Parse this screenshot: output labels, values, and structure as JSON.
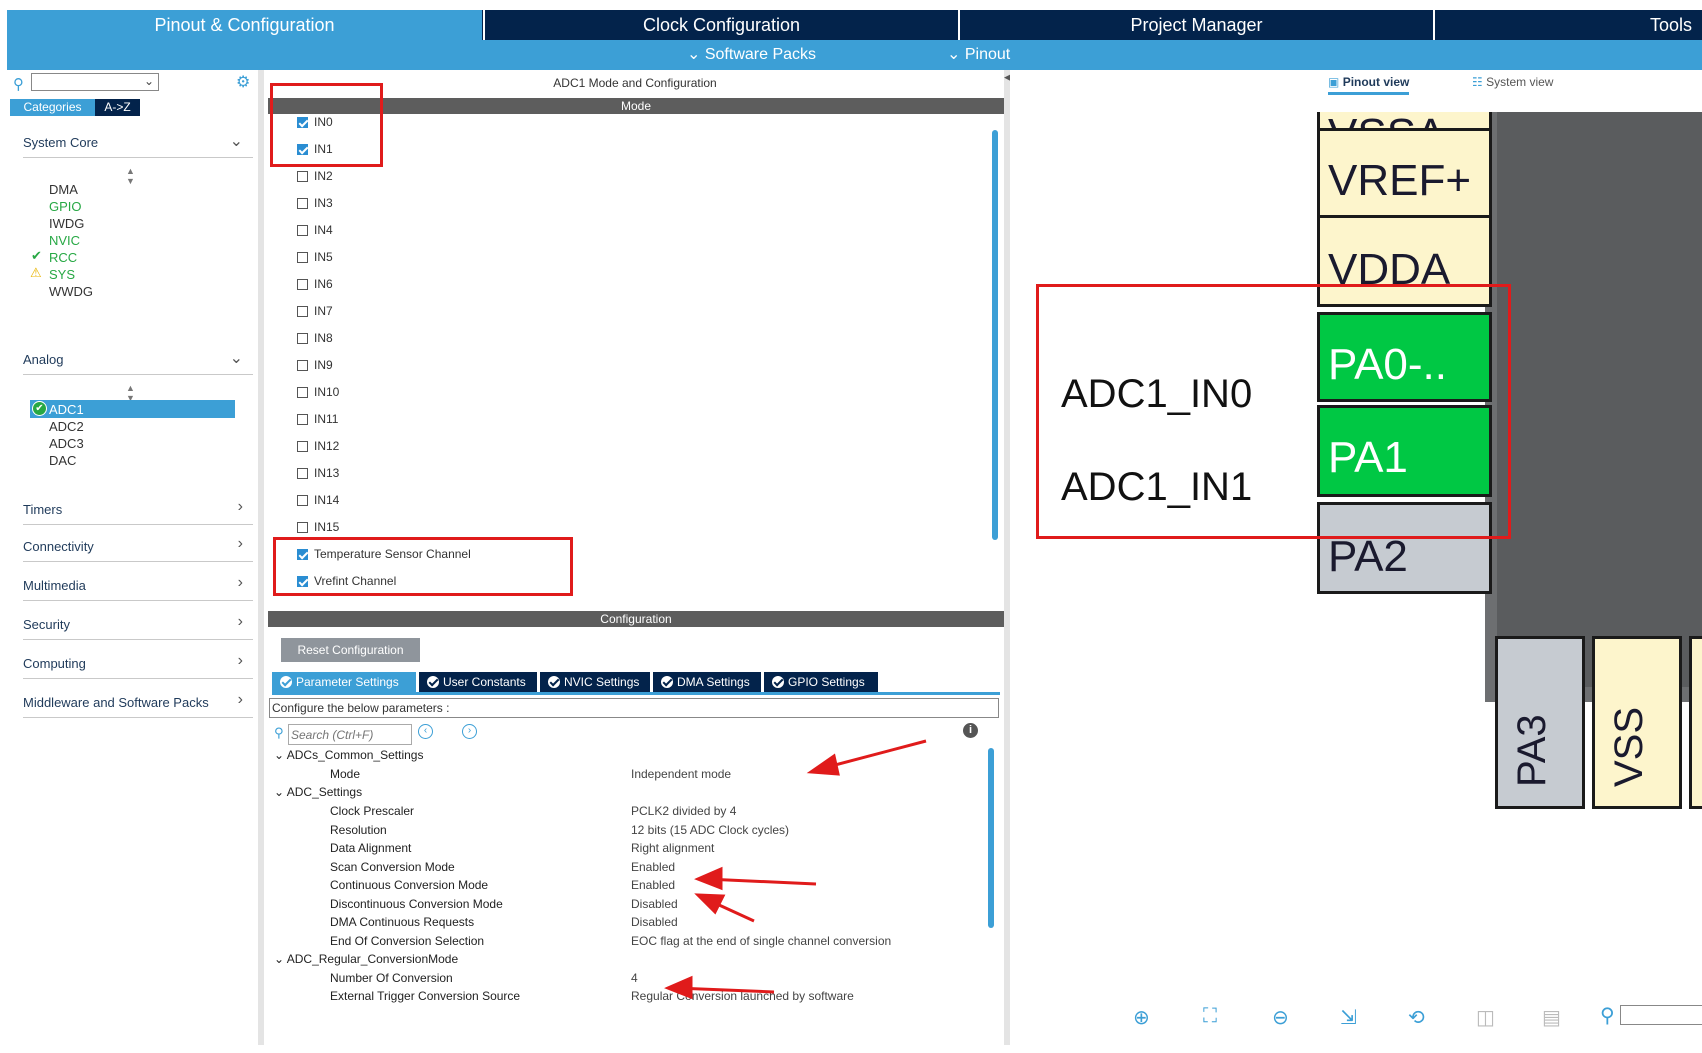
{
  "top_tabs": [
    "Pinout & Configuration",
    "Clock Configuration",
    "Project Manager",
    "Tools"
  ],
  "sub_menu": {
    "software_packs": "Software Packs",
    "pinout": "Pinout"
  },
  "left": {
    "tabs": [
      "Categories",
      "A->Z"
    ],
    "system_core": {
      "label": "System Core",
      "items": [
        "DMA",
        "GPIO",
        "IWDG",
        "NVIC",
        "RCC",
        "SYS",
        "WWDG"
      ]
    },
    "analog": {
      "label": "Analog",
      "items": [
        "ADC1",
        "ADC2",
        "ADC3",
        "DAC"
      ]
    },
    "categories": [
      "Timers",
      "Connectivity",
      "Multimedia",
      "Security",
      "Computing",
      "Middleware and Software Packs"
    ]
  },
  "mid": {
    "title": "ADC1 Mode and Configuration",
    "mode_header": "Mode",
    "channels": [
      "IN0",
      "IN1",
      "IN2",
      "IN3",
      "IN4",
      "IN5",
      "IN6",
      "IN7",
      "IN8",
      "IN9",
      "IN10",
      "IN11",
      "IN12",
      "IN13",
      "IN14",
      "IN15",
      "Temperature Sensor Channel",
      "Vrefint Channel"
    ],
    "checked": [
      true,
      true,
      false,
      false,
      false,
      false,
      false,
      false,
      false,
      false,
      false,
      false,
      false,
      false,
      false,
      false,
      true,
      true
    ],
    "config_header": "Configuration",
    "reset_button": "Reset Configuration",
    "config_tabs": [
      "Parameter Settings",
      "User Constants",
      "NVIC Settings",
      "DMA Settings",
      "GPIO Settings"
    ],
    "config_note": "Configure the below parameters :",
    "search_placeholder": "Search (Ctrl+F)",
    "params": {
      "common_group": "ADCs_Common_Settings",
      "mode": {
        "label": "Mode",
        "value": "Independent mode"
      },
      "adc_group": "ADC_Settings",
      "clock_prescaler": {
        "label": "Clock Prescaler",
        "value": "PCLK2 divided by 4"
      },
      "resolution": {
        "label": "Resolution",
        "value": "12 bits (15 ADC Clock cycles)"
      },
      "data_alignment": {
        "label": "Data Alignment",
        "value": "Right alignment"
      },
      "scan_mode": {
        "label": "Scan Conversion Mode",
        "value": "Enabled"
      },
      "continuous_mode": {
        "label": "Continuous Conversion Mode",
        "value": "Enabled"
      },
      "discontinuous_mode": {
        "label": "Discontinuous Conversion Mode",
        "value": "Disabled"
      },
      "dma_requests": {
        "label": "DMA Continuous Requests",
        "value": "Disabled"
      },
      "eoc_selection": {
        "label": "End Of Conversion Selection",
        "value": "EOC flag at the end of single channel conversion"
      },
      "regular_group": "ADC_Regular_ConversionMode",
      "num_conversion": {
        "label": "Number Of Conversion",
        "value": "4"
      },
      "ext_trigger_source": {
        "label": "External Trigger Conversion Source",
        "value": "Regular Conversion launched by software"
      }
    }
  },
  "right": {
    "pinout_view": "Pinout view",
    "system_view": "System view",
    "pins": {
      "vssa": "VSSA",
      "vref": "VREF+",
      "vdda": "VDDA",
      "pa0": "PA0-..",
      "pa1": "PA1",
      "pa2": "PA2",
      "pa3": "PA3",
      "vss": "VSS"
    },
    "labels": {
      "in0": "ADC1_IN0",
      "in1": "ADC1_IN1"
    }
  },
  "colors": {
    "header_navy": "#03234b",
    "accent_blue": "#3c9fd6",
    "pin_green": "#00c844",
    "pin_power": "#fdf5cc",
    "pin_gray": "#c6cbd1",
    "annotation_red": "#e01b1b"
  }
}
